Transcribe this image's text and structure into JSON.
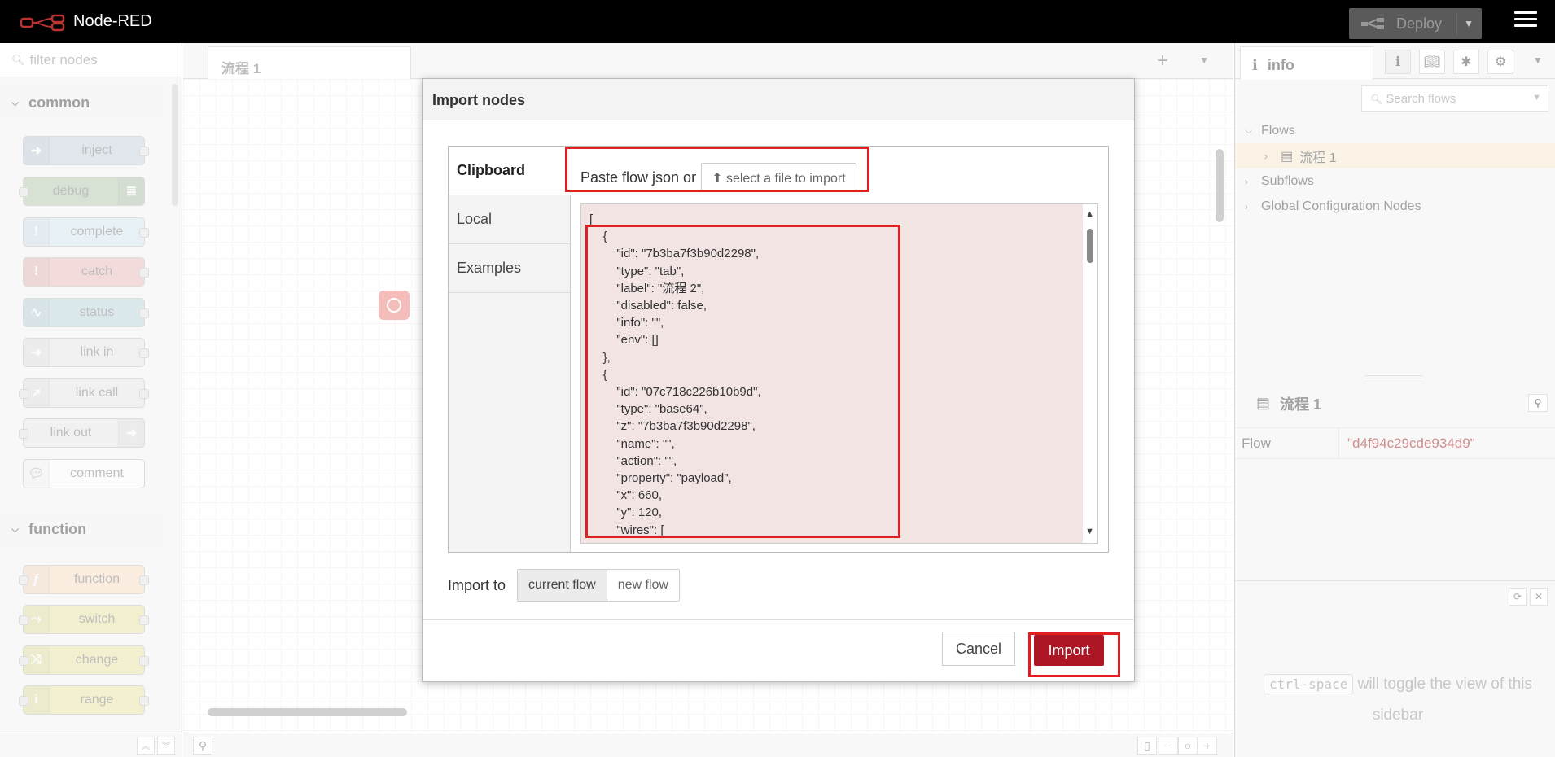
{
  "header": {
    "app_title": "Node-RED",
    "deploy_label": "Deploy"
  },
  "palette": {
    "filter_placeholder": "filter nodes",
    "categories": [
      {
        "label": "common"
      },
      {
        "label": "function"
      }
    ],
    "common_nodes": [
      {
        "label": "inject",
        "color": "#a6bbcf",
        "icon": "arrow-in-icon"
      },
      {
        "label": "debug",
        "color": "#87a980",
        "icon": "list-icon"
      },
      {
        "label": "complete",
        "color": "#c0deed",
        "icon": "exclamation-icon"
      },
      {
        "label": "catch",
        "color": "#e49191",
        "icon": "exclamation-icon"
      },
      {
        "label": "status",
        "color": "#94c1d0",
        "icon": "pulse-icon"
      },
      {
        "label": "link in",
        "color": "#dddddd",
        "icon": "link-icon"
      },
      {
        "label": "link call",
        "color": "#dddddd",
        "icon": "link-icon"
      },
      {
        "label": "link out",
        "color": "#dddddd",
        "icon": "link-icon"
      },
      {
        "label": "comment",
        "color": "#ffffff",
        "icon": "comment-icon"
      }
    ],
    "function_nodes": [
      {
        "label": "function",
        "color": "#fdd0a2",
        "icon": "function-icon"
      },
      {
        "label": "switch",
        "color": "#e2d96e",
        "icon": "switch-icon"
      },
      {
        "label": "change",
        "color": "#e2d96e",
        "icon": "shuffle-icon"
      },
      {
        "label": "range",
        "color": "#e2d96e",
        "icon": "range-icon"
      }
    ]
  },
  "workspace": {
    "tab_label": "流程 1"
  },
  "sidebar": {
    "tab_label": "info",
    "search_placeholder": "Search flows",
    "tree": {
      "flows": "Flows",
      "flow_item": "流程 1",
      "subflows": "Subflows",
      "global_config": "Global Configuration Nodes"
    },
    "props": {
      "title": "流程 1",
      "key": "Flow",
      "value": "\"d4f94c29cde934d9\""
    },
    "help": {
      "kbd": "ctrl-space",
      "text": " will toggle the view of this sidebar"
    }
  },
  "modal": {
    "title": "Import nodes",
    "nav": [
      "Clipboard",
      "Local",
      "Examples"
    ],
    "paste_label": "Paste flow json or",
    "file_button": "select a file to import",
    "json_text": "[\n    {\n        \"id\": \"7b3ba7f3b90d2298\",\n        \"type\": \"tab\",\n        \"label\": \"流程 2\",\n        \"disabled\": false,\n        \"info\": \"\",\n        \"env\": []\n    },\n    {\n        \"id\": \"07c718c226b10b9d\",\n        \"type\": \"base64\",\n        \"z\": \"7b3ba7f3b90d2298\",\n        \"name\": \"\",\n        \"action\": \"\",\n        \"property\": \"payload\",\n        \"x\": 660,\n        \"y\": 120,\n        \"wires\": [",
    "import_to_label": "Import to",
    "import_to_options": [
      "current flow",
      "new flow"
    ],
    "cancel_label": "Cancel",
    "import_label": "Import"
  },
  "colors": {
    "highlight": "#e02020",
    "import_button": "#ad1625"
  }
}
